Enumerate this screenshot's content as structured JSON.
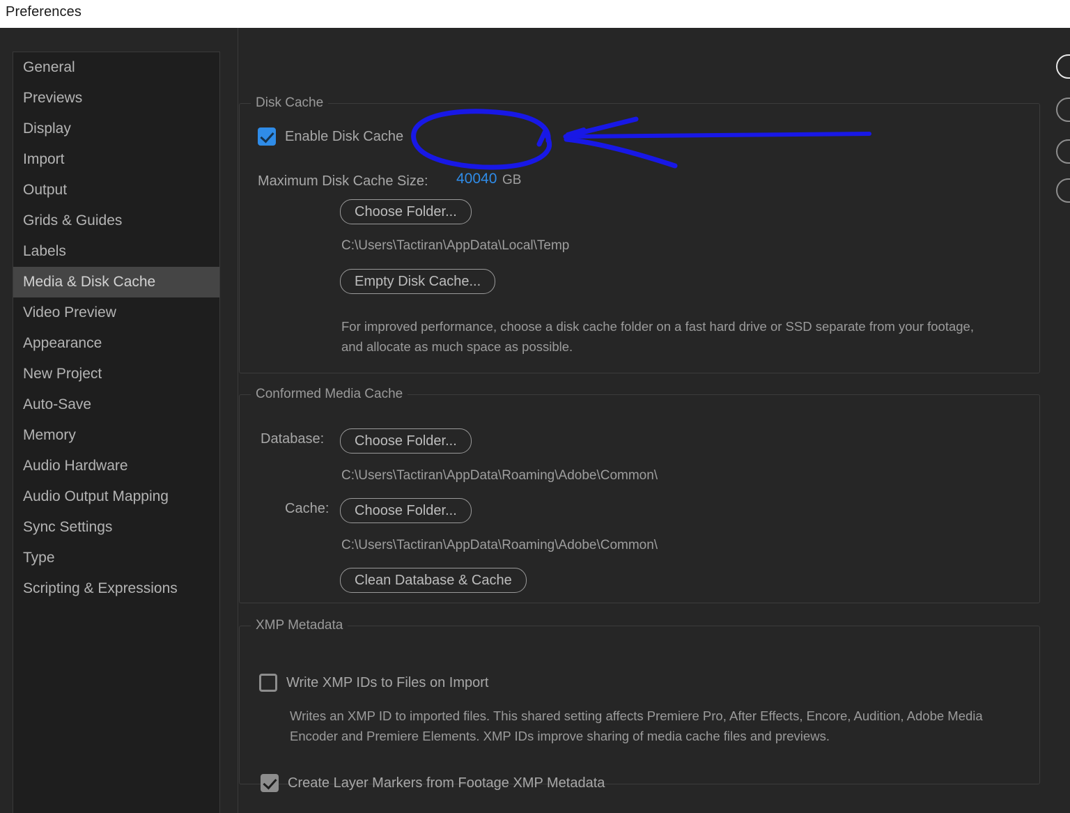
{
  "window": {
    "title": "Preferences"
  },
  "sidebar": {
    "items": [
      {
        "label": "General",
        "selected": false
      },
      {
        "label": "Previews",
        "selected": false
      },
      {
        "label": "Display",
        "selected": false
      },
      {
        "label": "Import",
        "selected": false
      },
      {
        "label": "Output",
        "selected": false
      },
      {
        "label": "Grids & Guides",
        "selected": false
      },
      {
        "label": "Labels",
        "selected": false
      },
      {
        "label": "Media & Disk Cache",
        "selected": true
      },
      {
        "label": "Video Preview",
        "selected": false
      },
      {
        "label": "Appearance",
        "selected": false
      },
      {
        "label": "New Project",
        "selected": false
      },
      {
        "label": "Auto-Save",
        "selected": false
      },
      {
        "label": "Memory",
        "selected": false
      },
      {
        "label": "Audio Hardware",
        "selected": false
      },
      {
        "label": "Audio Output Mapping",
        "selected": false
      },
      {
        "label": "Sync Settings",
        "selected": false
      },
      {
        "label": "Type",
        "selected": false
      },
      {
        "label": "Scripting & Expressions",
        "selected": false
      }
    ]
  },
  "disk_cache": {
    "legend": "Disk Cache",
    "enable_label": "Enable Disk Cache",
    "enable_checked": true,
    "max_size_label": "Maximum Disk Cache Size:",
    "max_size_value": "40040",
    "max_size_unit": "GB",
    "choose_folder_label": "Choose Folder...",
    "folder_path": "C:\\Users\\Tactiran\\AppData\\Local\\Temp",
    "empty_cache_label": "Empty Disk Cache...",
    "description": "For improved performance, choose a disk cache folder on a fast hard drive or SSD separate from your footage, and allocate as much space as possible."
  },
  "conformed_media_cache": {
    "legend": "Conformed Media Cache",
    "database_label": "Database:",
    "database_button": "Choose Folder...",
    "database_path": "C:\\Users\\Tactiran\\AppData\\Roaming\\Adobe\\Common\\",
    "cache_label": "Cache:",
    "cache_button": "Choose Folder...",
    "cache_path": "C:\\Users\\Tactiran\\AppData\\Roaming\\Adobe\\Common\\",
    "clean_button": "Clean Database & Cache"
  },
  "xmp_metadata": {
    "legend": "XMP Metadata",
    "write_ids_label": "Write XMP IDs to Files on Import",
    "write_ids_checked": false,
    "write_ids_description": "Writes an XMP ID to imported files. This shared setting affects Premiere Pro, After Effects, Encore, Audition, Adobe Media Encoder and Premiere Elements. XMP IDs improve sharing of media cache files and previews.",
    "create_markers_label": "Create Layer Markers from Footage XMP Metadata",
    "create_markers_checked": true
  },
  "annotation": {
    "color": "#1818e6",
    "shapes": "ellipse-around-cache-size, arrow-pointing-left-to-cache-size"
  },
  "colors": {
    "accent_blue": "#2f8ce8",
    "background": "#262626",
    "sidebar_background": "#1e1e1e",
    "selected_item": "#454545",
    "text": "#a8a8a8",
    "annotation_blue": "#1818e6"
  }
}
